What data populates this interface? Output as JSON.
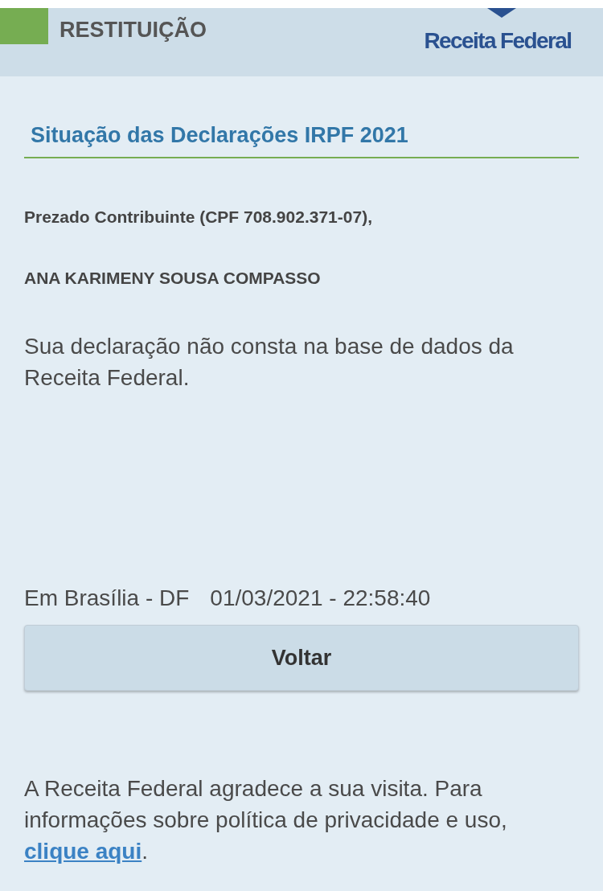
{
  "header": {
    "section_title": "RESTITUIÇÃO",
    "logo_text": "Receita Federal"
  },
  "page_title": "Situação das Declarações IRPF 2021",
  "greeting": "Prezado Contribuinte (CPF 708.902.371-07),",
  "taxpayer_name": "ANA KARIMENY SOUSA COMPASSO",
  "message": "Sua declaração não consta na base de dados da Receita Federal.",
  "location": "Em Brasília - DF",
  "timestamp": "01/03/2021 - 22:58:40",
  "back_button": "Voltar",
  "footer": {
    "text": "A Receita Federal agradece a sua visita. Para informações sobre política de privacidade e uso, ",
    "link": "clique aqui",
    "suffix": "."
  }
}
